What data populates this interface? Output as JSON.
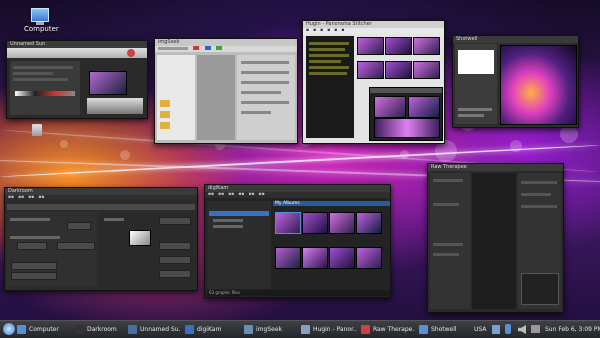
{
  "desktop": {
    "computer_icon_label": "Computer",
    "accent": "#4a9be0"
  },
  "windows": {
    "darkroom": {
      "title": "Darkroom"
    },
    "hugin": {
      "title": "Hugin - Panorama Stitcher"
    },
    "digikam": {
      "title": "digiKam",
      "panel_title": "My Albums",
      "status": "63 graphic files"
    },
    "imgseek": {
      "title": "imgSeek"
    },
    "rawtherapee": {
      "title": "Raw Therapee"
    },
    "shotwell": {
      "title": "Shotwell"
    },
    "unnamed": {
      "title": "Unnamed Sun"
    }
  },
  "taskbar": {
    "start_icon": "distro-logo-icon",
    "items": [
      {
        "label": "Computer",
        "icon": "computer-icon",
        "color": "#5a8fd0"
      },
      {
        "label": "Darkroom",
        "icon": "darkroom-icon",
        "color": "#333333"
      },
      {
        "label": "Unnamed Su...",
        "icon": "window-icon",
        "color": "#4a6fa0"
      },
      {
        "label": "digiKam",
        "icon": "digikam-icon",
        "color": "#3a70c0"
      },
      {
        "label": "imgSeek",
        "icon": "window-icon",
        "color": "#6a8fb0"
      },
      {
        "label": "Hugin - Panor...",
        "icon": "hugin-icon",
        "color": "#8aa0c0"
      },
      {
        "label": "Raw Therape...",
        "icon": "rawtherapee-icon",
        "color": "#d04040"
      },
      {
        "label": "Shotwell",
        "icon": "shotwell-icon",
        "color": "#5a8fd0"
      }
    ],
    "keyboard_layout": "USA",
    "clock": "Sun Feb 6, 3:09 PM"
  }
}
